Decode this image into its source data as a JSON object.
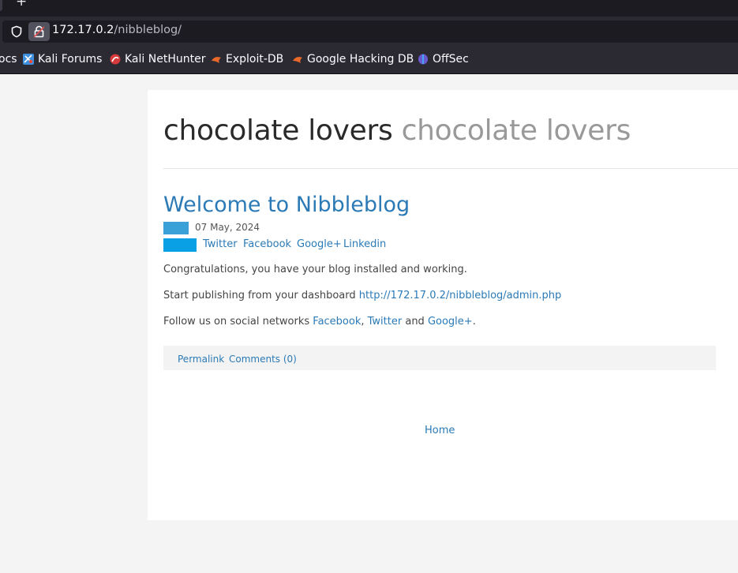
{
  "browser": {
    "new_tab_glyph": "+",
    "url_host": "172.17.0.2",
    "url_path": "/nibbleblog/",
    "bookmarks": [
      {
        "label": "ocs",
        "icon": "none"
      },
      {
        "label": "Kali Forums",
        "icon": "kali-forums-icon"
      },
      {
        "label": "Kali NetHunter",
        "icon": "kali-nethunter-icon"
      },
      {
        "label": "Exploit-DB",
        "icon": "exploit-db-icon"
      },
      {
        "label": "Google Hacking DB",
        "icon": "google-hacking-db-icon"
      },
      {
        "label": "OffSec",
        "icon": "offsec-icon"
      }
    ]
  },
  "blog": {
    "name": "chocolate lovers",
    "slogan": "chocolate lovers"
  },
  "post": {
    "title": "Welcome to Nibbleblog",
    "date": "07 May, 2024",
    "share": [
      "Twitter",
      "Facebook",
      "Google+",
      "Linkedin"
    ],
    "p1": "Congratulations, you have your blog installed and working.",
    "p2_text": "Start publishing from your dashboard ",
    "p2_link": "http://172.17.0.2/nibbleblog/admin.php",
    "p3_text": "Follow us on social networks ",
    "p3_link1": "Facebook",
    "p3_sep1": ", ",
    "p3_link2": "Twitter",
    "p3_and": " and ",
    "p3_link3": "Google+",
    "p3_end": ".",
    "permalink": "Permalink",
    "comments": "Comments (0)"
  },
  "nav": {
    "home": "Home"
  },
  "colors": {
    "link": "#2b7ab6",
    "date_box": "#3aa0d8",
    "share_box": "#0aa0e6"
  }
}
